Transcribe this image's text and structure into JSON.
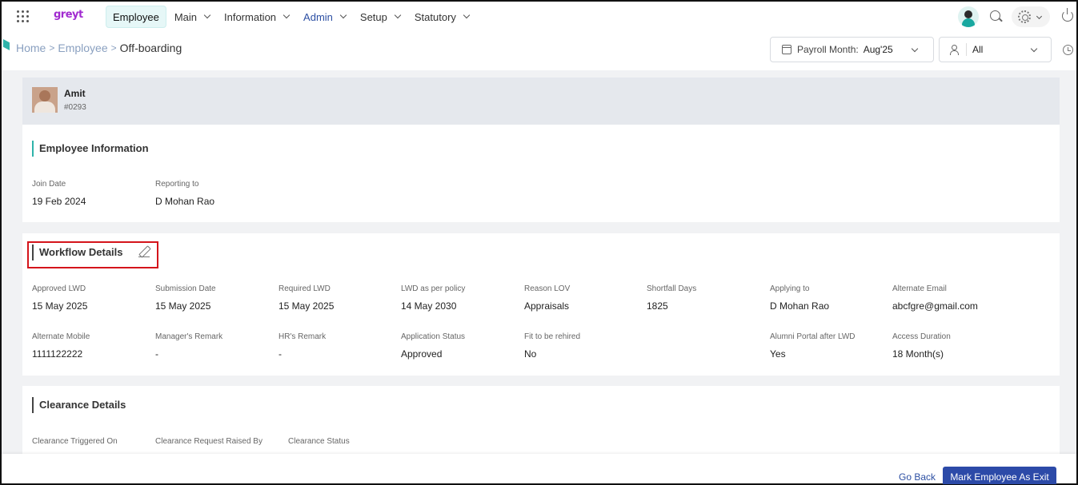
{
  "app": {
    "logo_text": "greyt"
  },
  "nav": {
    "items": [
      {
        "label": "Employee",
        "active": true,
        "dropdown": false
      },
      {
        "label": "Main",
        "dropdown": true
      },
      {
        "label": "Information",
        "dropdown": true
      },
      {
        "label": "Admin",
        "dropdown": true
      },
      {
        "label": "Setup",
        "dropdown": true
      },
      {
        "label": "Statutory",
        "dropdown": true
      }
    ]
  },
  "breadcrumb": {
    "home": "Home",
    "sep": ">",
    "employee": "Employee",
    "current": "Off-boarding"
  },
  "filters": {
    "payroll_label": "Payroll Month:",
    "payroll_value": "Aug'25",
    "group_value": "All"
  },
  "employee": {
    "name": "Amit",
    "code": "#0293"
  },
  "employee_info": {
    "title": "Employee Information",
    "fields": [
      {
        "label": "Join Date",
        "value": "19 Feb 2024"
      },
      {
        "label": "Reporting to",
        "value": "D Mohan Rao"
      }
    ]
  },
  "workflow": {
    "title": "Workflow Details",
    "row1": [
      {
        "label": "Approved LWD",
        "value": "15 May 2025"
      },
      {
        "label": "Submission Date",
        "value": "15 May 2025"
      },
      {
        "label": "Required LWD",
        "value": "15 May 2025"
      },
      {
        "label": "LWD as per policy",
        "value": "14 May 2030"
      },
      {
        "label": "Reason LOV",
        "value": "Appraisals"
      },
      {
        "label": "Shortfall Days",
        "value": "1825"
      },
      {
        "label": "Applying to",
        "value": "D Mohan Rao"
      },
      {
        "label": "Alternate Email",
        "value": "abcfgre@gmail.com"
      }
    ],
    "row2": [
      {
        "label": "Alternate Mobile",
        "value": "1111122222"
      },
      {
        "label": "Manager's Remark",
        "value": "-"
      },
      {
        "label": "HR's Remark",
        "value": "-"
      },
      {
        "label": "Application Status",
        "value": "Approved"
      },
      {
        "label": "Fit to be rehired",
        "value": "No"
      },
      {
        "label": "Alumni Portal after LWD",
        "value": "Yes"
      },
      {
        "label": "Access Duration",
        "value": "18 Month(s)"
      }
    ]
  },
  "clearance": {
    "title": "Clearance Details",
    "headers": [
      "Clearance Triggered On",
      "Clearance Request Raised By",
      "Clearance Status"
    ]
  },
  "footer": {
    "go_back": "Go Back",
    "mark_exit": "Mark Employee As Exit"
  }
}
